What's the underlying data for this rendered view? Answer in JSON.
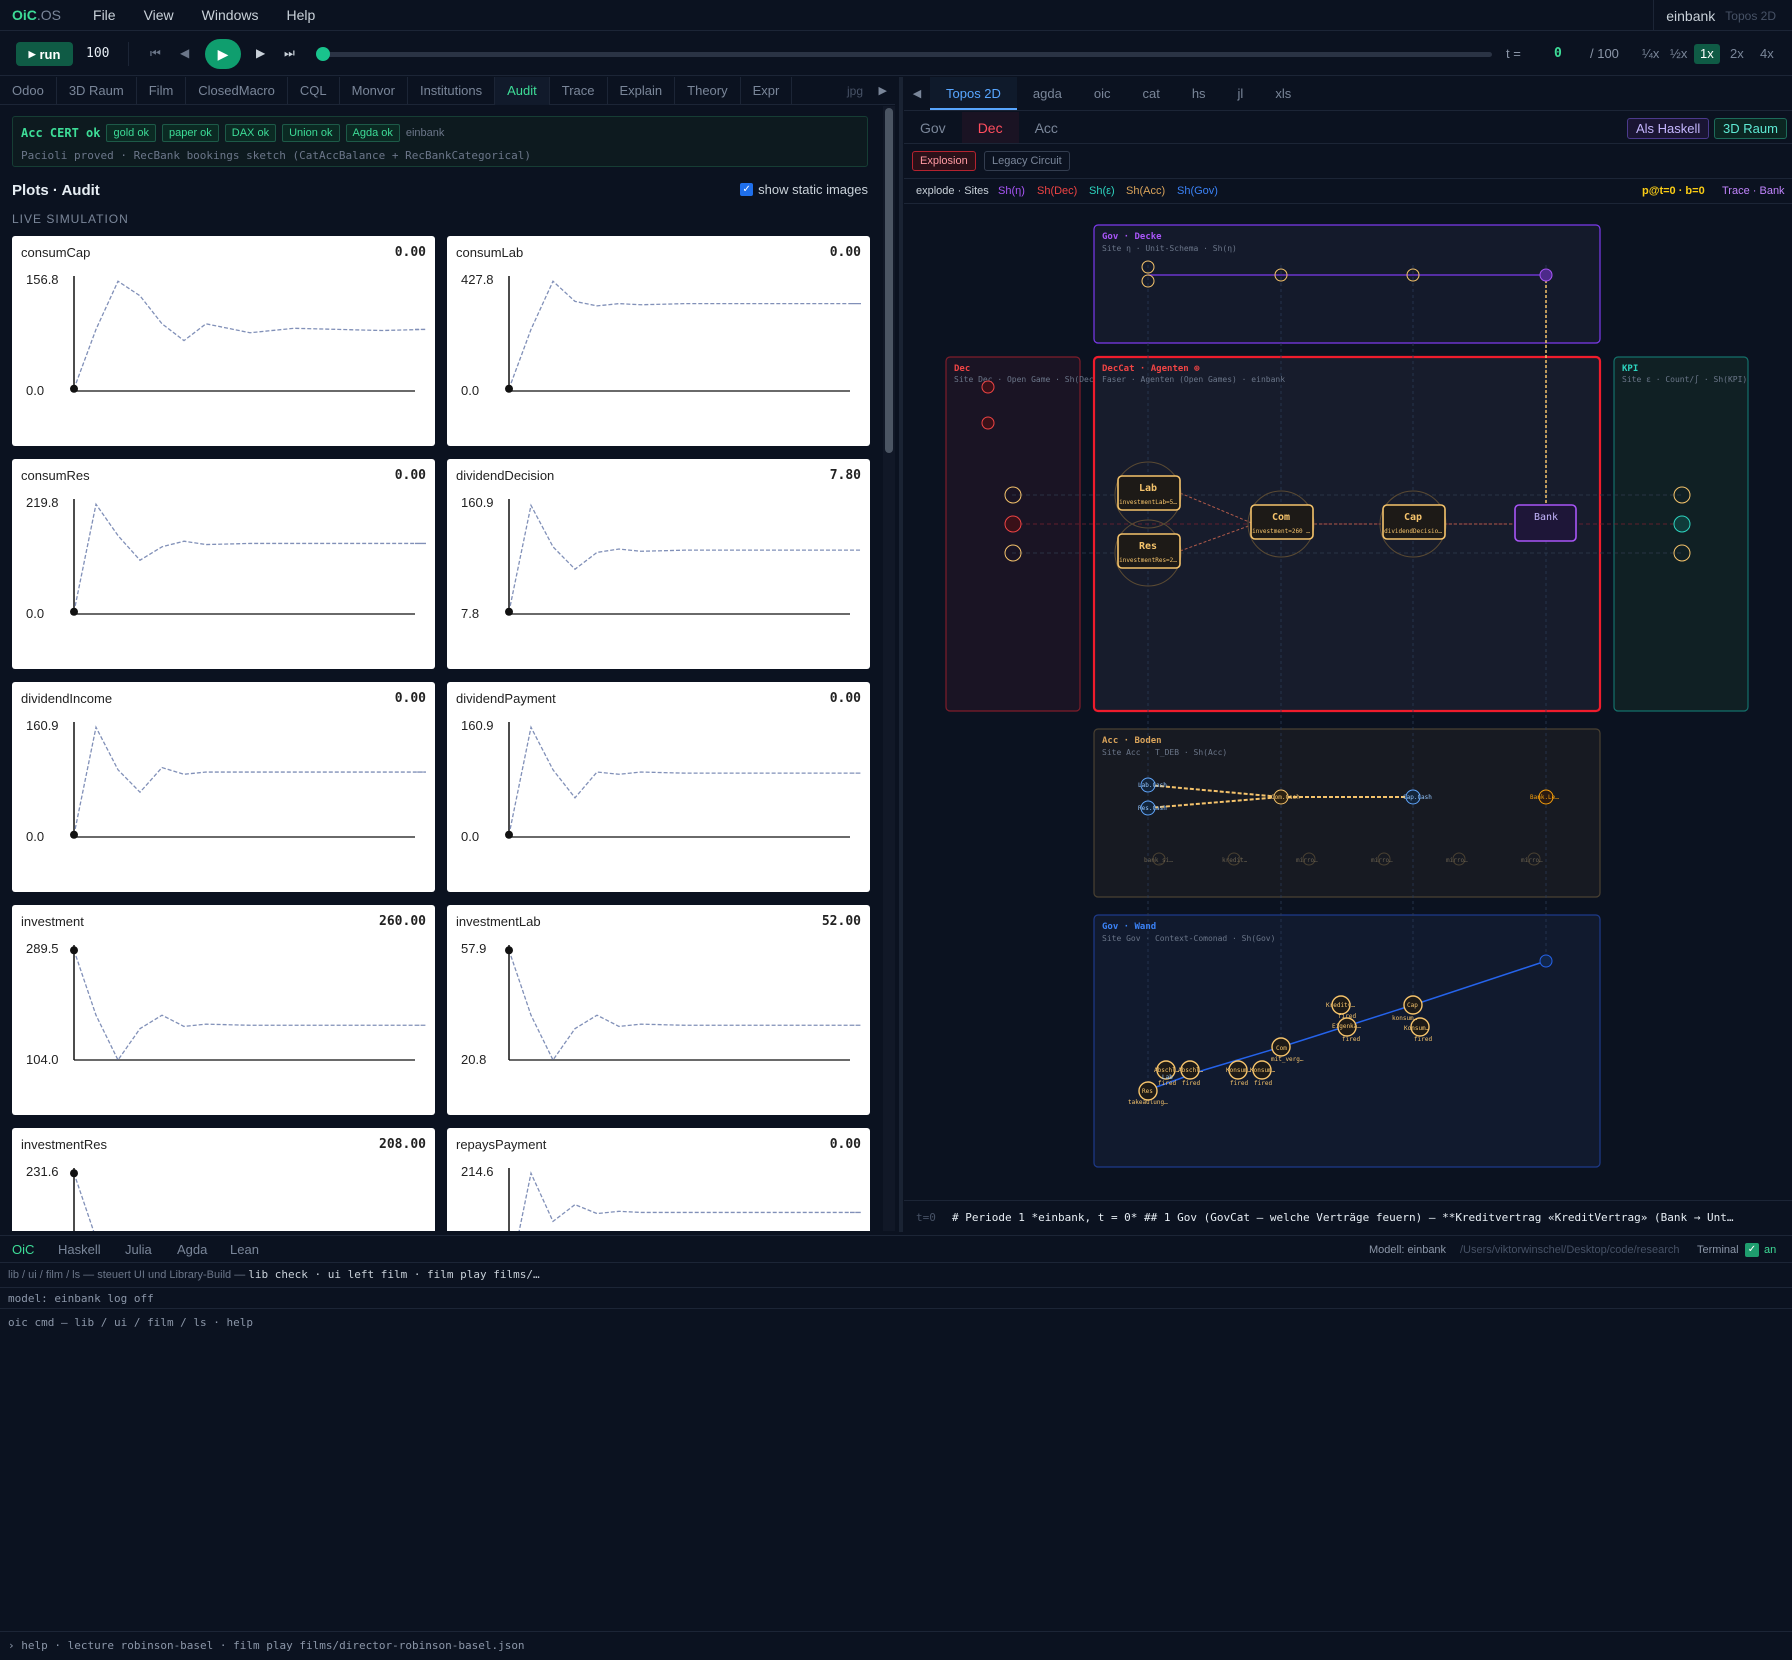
{
  "app": {
    "logo": "OiC",
    "logo_suffix": ".OS",
    "model": "einbank",
    "mode": "Topos 2D"
  },
  "menu": [
    "File",
    "View",
    "Windows",
    "Help"
  ],
  "transport": {
    "run_label": "run",
    "steps": "100",
    "t_label": "t =",
    "t_value": "0",
    "t_total": "/ 100",
    "speeds": [
      "¼x",
      "½x",
      "1x",
      "2x",
      "4x"
    ],
    "speed_active": "1x",
    "progress": 0.0
  },
  "left_tabs": [
    "Odoo",
    "3D Raum",
    "Film",
    "ClosedMacro",
    "CQL",
    "Monvor",
    "Institutions",
    "Audit",
    "Trace",
    "Explain",
    "Theory",
    "Expr"
  ],
  "left_tab_active": "Audit",
  "left_jpg": "jpg",
  "cert": {
    "title": "Acc CERT ok",
    "badges": [
      "gold ok",
      "paper ok",
      "DAX ok",
      "Union ok",
      "Agda ok"
    ],
    "model": "einbank",
    "line2": "Pacioli proved · RecBank bookings sketch (CatAccBalance + RecBankCategorical)"
  },
  "plots": {
    "title": "Plots · Audit",
    "show_static": "show static images",
    "live": "LIVE SIMULATION"
  },
  "chart_data": [
    {
      "type": "line",
      "title": "consumCap",
      "current": "0.00",
      "ymax": "156.8",
      "ymin": "0.0"
    },
    {
      "type": "line",
      "title": "consumLab",
      "current": "0.00",
      "ymax": "427.8",
      "ymin": "0.0"
    },
    {
      "type": "line",
      "title": "consumRes",
      "current": "0.00",
      "ymax": "219.8",
      "ymin": "0.0"
    },
    {
      "type": "line",
      "title": "dividendDecision",
      "current": "7.80",
      "ymax": "160.9",
      "ymin": "7.8"
    },
    {
      "type": "line",
      "title": "dividendIncome",
      "current": "0.00",
      "ymax": "160.9",
      "ymin": "0.0"
    },
    {
      "type": "line",
      "title": "dividendPayment",
      "current": "0.00",
      "ymax": "160.9",
      "ymin": "0.0"
    },
    {
      "type": "line",
      "title": "investment",
      "current": "260.00",
      "ymax": "289.5",
      "ymin": "104.0"
    },
    {
      "type": "line",
      "title": "investmentLab",
      "current": "52.00",
      "ymax": "57.9",
      "ymin": "20.8"
    },
    {
      "type": "line",
      "title": "investmentRes",
      "current": "208.00",
      "ymax": "231.6",
      "ymin": ""
    },
    {
      "type": "line",
      "title": "repaysPayment",
      "current": "0.00",
      "ymax": "214.6",
      "ymin": ""
    }
  ],
  "right_tabs": [
    "Topos 2D",
    "agda",
    "oic",
    "cat",
    "hs",
    "jl",
    "xls"
  ],
  "right_tab_active": "Topos 2D",
  "levels": [
    "Gov",
    "Dec",
    "Acc"
  ],
  "level_active": "Dec",
  "buttons": {
    "haskell": "Als Haskell",
    "raum": "3D Raum",
    "explosion": "Explosion",
    "legacy": "Legacy Circuit"
  },
  "legend": {
    "explode": "explode · Sites",
    "sh_eta": "Sh(η)",
    "sh_dec": "Sh(Dec)",
    "sh_eps": "Sh(ε)",
    "sh_acc": "Sh(Acc)",
    "sh_gov": "Sh(Gov)",
    "pt": "p@t=0 · b=0",
    "trace": "Trace · Bank"
  },
  "topos": {
    "gov_top": {
      "title": "Gov · Decke",
      "sub": "Site η · Unit-Schema · Sh(η)"
    },
    "dec": {
      "title": "Dec",
      "sub": "Site Dec · Open Game · Sh(Dec)"
    },
    "deccat": {
      "title": "DecCat · Agenten ⊕",
      "sub": "Faser · Agenten (Open Games) · einbank"
    },
    "kpi": {
      "title": "KPI",
      "sub": "Site ε · Count/∫ · Sh(KPI)"
    },
    "acc": {
      "title": "Acc · Boden",
      "sub": "Site Acc · T_DEB · Sh(Acc)"
    },
    "gov": {
      "title": "Gov · Wand",
      "sub": "Site Gov · Context-Comonad · Sh(Gov)"
    },
    "nodes": {
      "lab": "Lab",
      "lab_sub": "investmentLab=5…",
      "res": "Res",
      "res_sub": "investmentRes=2…",
      "com": "Com",
      "com_sub": "investment=260 …",
      "cap": "Cap",
      "cap_sub": "dividendDecisio…",
      "bank": "Bank"
    },
    "acc_labels": [
      "bank_si…",
      "kredit…",
      "mirro…",
      "mirro…",
      "mirro…",
      "mirro…"
    ],
    "acc_top_labels": [
      "Lab.Cash",
      "Res.Cash",
      "Com.Cash",
      "Cap.Cash",
      "Bank.Le…"
    ],
    "gov_labels": [
      "Kreditv…",
      "fired",
      "Eigenka…",
      "fired",
      "Cap",
      "konsum…",
      "Konsum…",
      "fired",
      "Com",
      "mit_verg…",
      "Konsum…",
      "Konsum…",
      "fired",
      "fired",
      "Abschl…",
      "Abschl…",
      "fired",
      "fired",
      "Res",
      "Lab",
      "takeaulung…"
    ]
  },
  "cmdline": {
    "t": "t=0",
    "text": "# Periode 1 *einbank, t = 0* ## 1 Gov (GovCat — welche Verträge feuern) — **Kreditvertrag «KreditVertrag» (Bank → Unt…"
  },
  "bottom_tabs": [
    "OiC",
    "Haskell",
    "Julia",
    "Agda",
    "Lean"
  ],
  "bottom_tab_active": "OiC",
  "bottom_status": {
    "model": "Modell: einbank",
    "path": "/Users/viktorwinschel/Desktop/code/research",
    "terminal": "Terminal",
    "an": "an"
  },
  "terminal": {
    "line1": "lib / ui / film / ls — steuert UI und Library-Build —",
    "line1_cmd": "lib check · ui left film · film play films/…",
    "line2": "model: einbank  log off",
    "line3": "oic cmd — lib / ui / film / ls · help"
  },
  "hint": "› help · lecture robinson-basel · film play films/director-robinson-basel.json"
}
